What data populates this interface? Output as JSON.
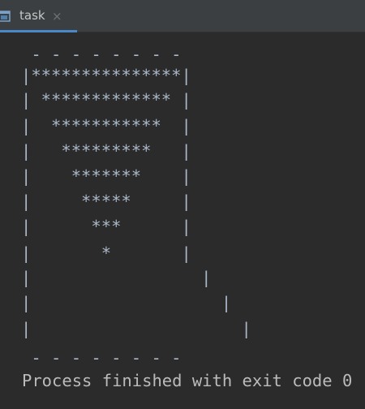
{
  "tab": {
    "label": "task",
    "close_glyph": "×",
    "icon": "console-window-icon"
  },
  "console": {
    "lines": [
      " - - - - - - - -",
      "|***************|",
      "| ************* |",
      "|  ***********  |",
      "|   *********   |",
      "|    *******    |",
      "|     *****     |",
      "|      ***      |",
      "|       *       |",
      "|                 |",
      "|                   |",
      "|                     |",
      "",
      " - - - - - - - -",
      "Process finished with exit code 0"
    ]
  },
  "colors": {
    "background": "#2b2b2b",
    "tabbar": "#3c3f41",
    "tab_underline": "#4a88c7",
    "text": "#a9b7c6"
  }
}
